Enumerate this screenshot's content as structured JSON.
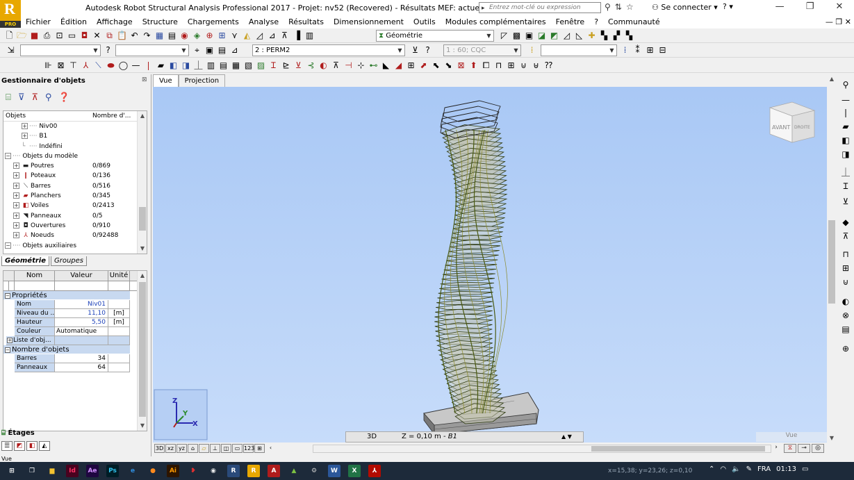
{
  "titlebar": {
    "logo_letter": "R",
    "logo_pro": "PRO",
    "title": "Autodesk Robot Structural Analysis Professional 2017 - Projet: nv52 (Recovered) - Résultats MEF: actuels",
    "search_placeholder": "Entrez mot-clé ou expression",
    "login_label": "Se connecter",
    "help_label": "?"
  },
  "menu": [
    "Fichier",
    "Édition",
    "Affichage",
    "Structure",
    "Chargements",
    "Analyse",
    "Résultats",
    "Dimensionnement",
    "Outils",
    "Modules complémentaires",
    "Fenêtre",
    "?",
    "Communauté"
  ],
  "toolbar": {
    "view_combo": "Géométrie",
    "case_combo": "2 : PERM2",
    "combo_disabled": "1 : 60; CQC",
    "t2_icon1": "?",
    "t2_icon2": "?"
  },
  "object_manager": {
    "title": "Gestionnaire d'objets",
    "col_objects": "Objets",
    "col_count": "Nombre d'...",
    "tree": [
      {
        "label": "Niv00",
        "count": "",
        "indent": 2,
        "exp": "+"
      },
      {
        "label": "B1",
        "count": "",
        "indent": 2,
        "exp": "+"
      },
      {
        "label": "Indéfini",
        "count": "",
        "indent": 2,
        "exp": ""
      },
      {
        "label": "Objets du modèle",
        "count": "",
        "indent": 0,
        "exp": "−"
      },
      {
        "label": "Poutres",
        "count": "0/869",
        "indent": 1,
        "exp": "+",
        "icon": "beam-icon"
      },
      {
        "label": "Poteaux",
        "count": "0/136",
        "indent": 1,
        "exp": "+",
        "icon": "column-icon"
      },
      {
        "label": "Barres",
        "count": "0/516",
        "indent": 1,
        "exp": "+",
        "icon": "bar-icon"
      },
      {
        "label": "Planchers",
        "count": "0/345",
        "indent": 1,
        "exp": "+",
        "icon": "floor-icon"
      },
      {
        "label": "Voiles",
        "count": "0/2413",
        "indent": 1,
        "exp": "+",
        "icon": "wall-icon"
      },
      {
        "label": "Panneaux",
        "count": "0/5",
        "indent": 1,
        "exp": "+",
        "icon": "panel-icon"
      },
      {
        "label": "Ouvertures",
        "count": "0/910",
        "indent": 1,
        "exp": "+",
        "icon": "opening-icon"
      },
      {
        "label": "Noeuds",
        "count": "0/92488",
        "indent": 1,
        "exp": "+",
        "icon": "node-icon"
      },
      {
        "label": "Objets auxiliaires",
        "count": "",
        "indent": 0,
        "exp": "−"
      }
    ],
    "tab_geometry": "Géométrie",
    "tab_groups": "Groupes"
  },
  "properties": {
    "col_name": "Nom",
    "col_value": "Valeur",
    "col_unit": "Unité",
    "section_props": "Propriétés",
    "rows": [
      {
        "name": "Nom",
        "value": "Niv01",
        "unit": ""
      },
      {
        "name": "Niveau du ...",
        "value": "11,10",
        "unit": "[m]"
      },
      {
        "name": "Hauteur",
        "value": "5,50",
        "unit": "[m]"
      },
      {
        "name": "Couleur",
        "value": "Automatique",
        "unit": ""
      }
    ],
    "list_row": "Liste d'obj...",
    "section_count": "Nombre d'objets",
    "count_rows": [
      {
        "name": "Barres",
        "value": "34"
      },
      {
        "name": "Panneaux",
        "value": "64"
      }
    ],
    "etages_label": "Étages"
  },
  "view": {
    "tab_vue": "Vue",
    "tab_projection": "Projection",
    "cube_front": "AVANT",
    "cube_right": "DROITE",
    "status_3d": "3D",
    "status_z": "Z = 0,10 m - ",
    "status_level": "B1",
    "vue_label": "Vue",
    "axis_x": "X",
    "axis_y": "Y",
    "axis_z": "Z"
  },
  "status": {
    "vue": "Vue",
    "coords": "x=15,38; y=23,26; z=0,10",
    "lang": "FRA",
    "time": "01:13"
  },
  "taskbar_icons": [
    {
      "name": "start-icon",
      "label": "⊞",
      "bg": "#1d2a3a",
      "fg": "#ffffff"
    },
    {
      "name": "task-view-icon",
      "label": "❐",
      "bg": "#1d2a3a",
      "fg": "#ffffff"
    },
    {
      "name": "explorer-icon",
      "label": "▆",
      "bg": "#1d2a3a",
      "fg": "#f2c230"
    },
    {
      "name": "indesign-icon",
      "label": "Id",
      "bg": "#49021f",
      "fg": "#ff3366"
    },
    {
      "name": "aftereffects-icon",
      "label": "Ae",
      "bg": "#1f0740",
      "fg": "#d291ff"
    },
    {
      "name": "photoshop-icon",
      "label": "Ps",
      "bg": "#001d26",
      "fg": "#31c5f0"
    },
    {
      "name": "edge-icon",
      "label": "e",
      "bg": "#1d2a3a",
      "fg": "#2f8ee0"
    },
    {
      "name": "firefox-icon",
      "label": "●",
      "bg": "#1d2a3a",
      "fg": "#ff8a1d"
    },
    {
      "name": "illustrator-icon",
      "label": "Ai",
      "bg": "#2d1500",
      "fg": "#ff9a00"
    },
    {
      "name": "app-red-icon",
      "label": "❥",
      "bg": "#1d2a3a",
      "fg": "#e03030"
    },
    {
      "name": "chrome-icon",
      "label": "◉",
      "bg": "#1d2a3a",
      "fg": "#eaeaea"
    },
    {
      "name": "robot-icon",
      "label": "R",
      "bg": "#2a4a7a",
      "fg": "#ffffff"
    },
    {
      "name": "robot-pro-icon",
      "label": "R",
      "bg": "#e8a800",
      "fg": "#ffffff"
    },
    {
      "name": "autocad-icon",
      "label": "A",
      "bg": "#b01c1c",
      "fg": "#ffffff"
    },
    {
      "name": "android-icon",
      "label": "▲",
      "bg": "#1d2a3a",
      "fg": "#7cc142"
    },
    {
      "name": "network-app-icon",
      "label": "⚙",
      "bg": "#1d2a3a",
      "fg": "#cccccc"
    },
    {
      "name": "word-icon",
      "label": "W",
      "bg": "#2b579a",
      "fg": "#ffffff"
    },
    {
      "name": "excel-icon",
      "label": "X",
      "bg": "#217346",
      "fg": "#ffffff"
    },
    {
      "name": "acrobat-icon",
      "label": "⅄",
      "bg": "#b30b00",
      "fg": "#ffffff"
    }
  ]
}
